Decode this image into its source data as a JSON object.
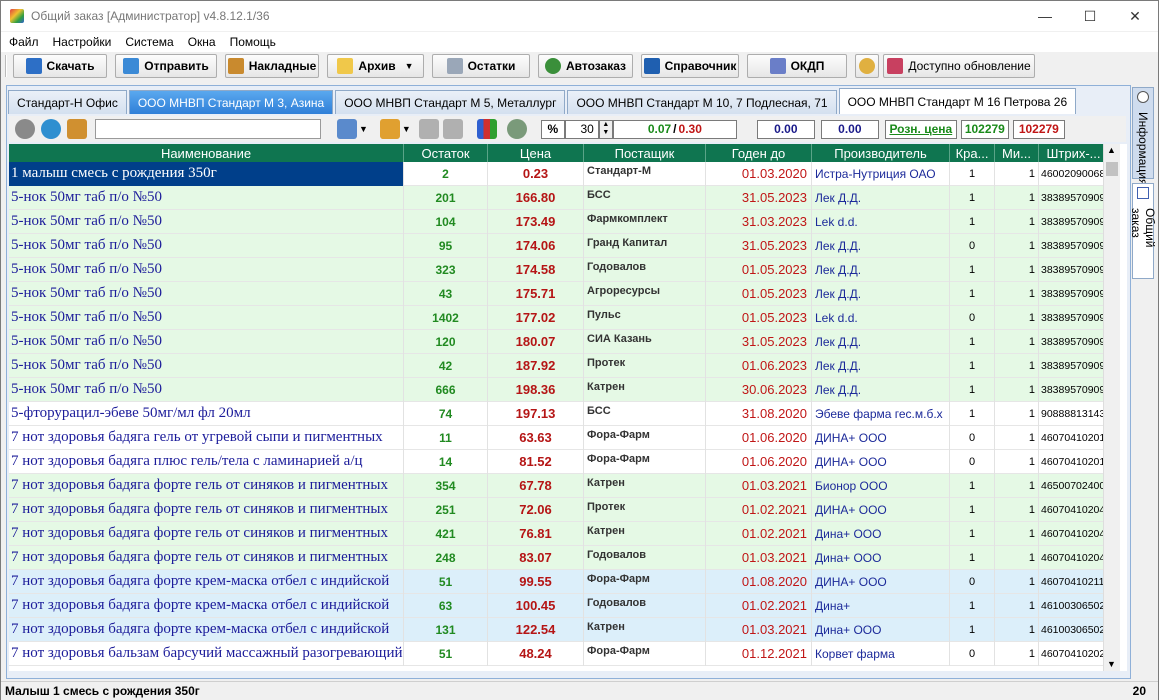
{
  "window": {
    "title": "Общий заказ [Администратор] v4.8.12.1/36",
    "minimize": "—",
    "maximize": "☐",
    "close": "✕"
  },
  "menu": [
    "Файл",
    "Настройки",
    "Система",
    "Окна",
    "Помощь"
  ],
  "toolbar": {
    "download": "Скачать",
    "send": "Отправить",
    "invoices": "Накладные",
    "archive": "Архив",
    "stock": "Остатки",
    "autoorder": "Автозаказ",
    "reference": "Справочник",
    "okdp": "ОКДП",
    "update": "Доступно обновление"
  },
  "tabs": [
    "Стандарт-Н Офис",
    "ООО МНВП Стандарт М 3, Азина",
    "ООО МНВП Стандарт М 5, Металлург",
    "ООО МНВП Стандарт М 10, 7 Подлесная, 71",
    "ООО МНВП Стандарт М 16 Петрова 26"
  ],
  "filters": {
    "percent_symbol": "%",
    "percent_value": "30",
    "ratio_green": "0.07",
    "ratio_sep": "/",
    "ratio_red": "0.30",
    "sum1": "0.00",
    "sum2": "0.00",
    "retail_price_link": "Розн. цена",
    "count_green": "102279",
    "count_red": "102279"
  },
  "columns": [
    "Наименование",
    "Остаток",
    "Цена",
    "Постащик",
    "Годен до",
    "Производитель",
    "Кра...",
    "Ми...",
    "Штрих-..."
  ],
  "rows": [
    {
      "name": "1 малыш смесь с рождения 350г",
      "stock": "2",
      "price": "0.23",
      "supplier": "Стандарт-М",
      "expiry": "01.03.2020",
      "mfr": "Истра-Нутриция ОАО",
      "kr": "1",
      "mi": "1",
      "barcode": "46002090068"
    },
    {
      "name": "5-нок 50мг таб п/о №50",
      "stock": "201",
      "price": "166.80",
      "supplier": "БСС",
      "expiry": "31.05.2023",
      "mfr": "Лек Д.Д.",
      "kr": "1",
      "mi": "1",
      "barcode": "38389570909"
    },
    {
      "name": "5-нок 50мг таб п/о №50",
      "stock": "104",
      "price": "173.49",
      "supplier": "Фармкомплект",
      "expiry": "31.03.2023",
      "mfr": "Lek d.d.",
      "kr": "1",
      "mi": "1",
      "barcode": "38389570909"
    },
    {
      "name": "5-нок 50мг таб п/о №50",
      "stock": "95",
      "price": "174.06",
      "supplier": "Гранд Капитал",
      "expiry": "31.05.2023",
      "mfr": "Лек Д.Д.",
      "kr": "0",
      "mi": "1",
      "barcode": "38389570909"
    },
    {
      "name": "5-нок 50мг таб п/о №50",
      "stock": "323",
      "price": "174.58",
      "supplier": "Годовалов",
      "expiry": "01.05.2023",
      "mfr": "Лек Д.Д.",
      "kr": "1",
      "mi": "1",
      "barcode": "38389570909"
    },
    {
      "name": "5-нок 50мг таб п/о №50",
      "stock": "43",
      "price": "175.71",
      "supplier": "Агроресурсы",
      "expiry": "01.05.2023",
      "mfr": "Лек Д.Д.",
      "kr": "1",
      "mi": "1",
      "barcode": "38389570909"
    },
    {
      "name": "5-нок 50мг таб п/о №50",
      "stock": "1402",
      "price": "177.02",
      "supplier": "Пульс",
      "expiry": "01.05.2023",
      "mfr": "Lek d.d.",
      "kr": "0",
      "mi": "1",
      "barcode": "38389570909"
    },
    {
      "name": "5-нок 50мг таб п/о №50",
      "stock": "120",
      "price": "180.07",
      "supplier": "СИА Казань",
      "expiry": "31.05.2023",
      "mfr": "Лек Д.Д.",
      "kr": "1",
      "mi": "1",
      "barcode": "38389570909"
    },
    {
      "name": "5-нок 50мг таб п/о №50",
      "stock": "42",
      "price": "187.92",
      "supplier": "Протек",
      "expiry": "01.06.2023",
      "mfr": "Лек Д.Д.",
      "kr": "1",
      "mi": "1",
      "barcode": "38389570909"
    },
    {
      "name": "5-нок 50мг таб п/о №50",
      "stock": "666",
      "price": "198.36",
      "supplier": "Катрен",
      "expiry": "30.06.2023",
      "mfr": "Лек Д.Д.",
      "kr": "1",
      "mi": "1",
      "barcode": "38389570909"
    },
    {
      "name": "5-фторурацил-эбеве 50мг/мл фл 20мл",
      "stock": "74",
      "price": "197.13",
      "supplier": "БСС",
      "expiry": "31.08.2020",
      "mfr": "Эбеве фарма гес.м.б.х",
      "kr": "1",
      "mi": "1",
      "barcode": "90888813143"
    },
    {
      "name": "7 нот здоровья бадяга гель от угревой сыпи и пигментных",
      "stock": "11",
      "price": "63.63",
      "supplier": "Фора-Фарм",
      "expiry": "01.06.2020",
      "mfr": "ДИНА+ ООО",
      "kr": "0",
      "mi": "1",
      "barcode": "46070410201"
    },
    {
      "name": "7 нот здоровья бадяга плюс гель/тела с ламинарией а/ц",
      "stock": "14",
      "price": "81.52",
      "supplier": "Фора-Фарм",
      "expiry": "01.06.2020",
      "mfr": "ДИНА+ ООО",
      "kr": "0",
      "mi": "1",
      "barcode": "46070410201"
    },
    {
      "name": "7 нот здоровья бадяга форте гель от синяков и пигментных",
      "stock": "354",
      "price": "67.78",
      "supplier": "Катрен",
      "expiry": "01.03.2021",
      "mfr": "Бионор ООО",
      "kr": "1",
      "mi": "1",
      "barcode": "46500702400"
    },
    {
      "name": "7 нот здоровья бадяга форте гель от синяков и пигментных",
      "stock": "251",
      "price": "72.06",
      "supplier": "Протек",
      "expiry": "01.02.2021",
      "mfr": "ДИНА+ ООО",
      "kr": "1",
      "mi": "1",
      "barcode": "46070410204"
    },
    {
      "name": "7 нот здоровья бадяга форте гель от синяков и пигментных",
      "stock": "421",
      "price": "76.81",
      "supplier": "Катрен",
      "expiry": "01.02.2021",
      "mfr": "Дина+ ООО",
      "kr": "1",
      "mi": "1",
      "barcode": "46070410204"
    },
    {
      "name": "7 нот здоровья бадяга форте гель от синяков и пигментных",
      "stock": "248",
      "price": "83.07",
      "supplier": "Годовалов",
      "expiry": "01.03.2021",
      "mfr": "Дина+ ООО",
      "kr": "1",
      "mi": "1",
      "barcode": "46070410204"
    },
    {
      "name": "7 нот здоровья бадяга форте крем-маска отбел с индийской",
      "stock": "51",
      "price": "99.55",
      "supplier": "Фора-Фарм",
      "expiry": "01.08.2020",
      "mfr": "ДИНА+ ООО",
      "kr": "0",
      "mi": "1",
      "barcode": "46070410211"
    },
    {
      "name": "7 нот здоровья бадяга форте крем-маска отбел с индийской",
      "stock": "63",
      "price": "100.45",
      "supplier": "Годовалов",
      "expiry": "01.02.2021",
      "mfr": "Дина+",
      "kr": "1",
      "mi": "1",
      "barcode": "46100306502"
    },
    {
      "name": "7 нот здоровья бадяга форте крем-маска отбел с индийской",
      "stock": "131",
      "price": "122.54",
      "supplier": "Катрен",
      "expiry": "01.03.2021",
      "mfr": "Дина+ ООО",
      "kr": "1",
      "mi": "1",
      "barcode": "46100306502"
    },
    {
      "name": "7 нот здоровья бальзам барсучий массажный разогревающий",
      "stock": "51",
      "price": "48.24",
      "supplier": "Фора-Фарм",
      "expiry": "01.12.2021",
      "mfr": "Корвет фарма",
      "kr": "0",
      "mi": "1",
      "barcode": "46070410202"
    }
  ],
  "row_bg": [
    "sel",
    "green",
    "green",
    "green",
    "green",
    "green",
    "green",
    "green",
    "green",
    "green",
    "white",
    "white",
    "white",
    "green",
    "green",
    "green",
    "green",
    "blue",
    "blue",
    "blue",
    "white"
  ],
  "right_tabs": {
    "info": "Информация",
    "order": "Общий заказ"
  },
  "status": {
    "text": "Малыш 1 смесь с рождения 350г",
    "count": "20"
  }
}
